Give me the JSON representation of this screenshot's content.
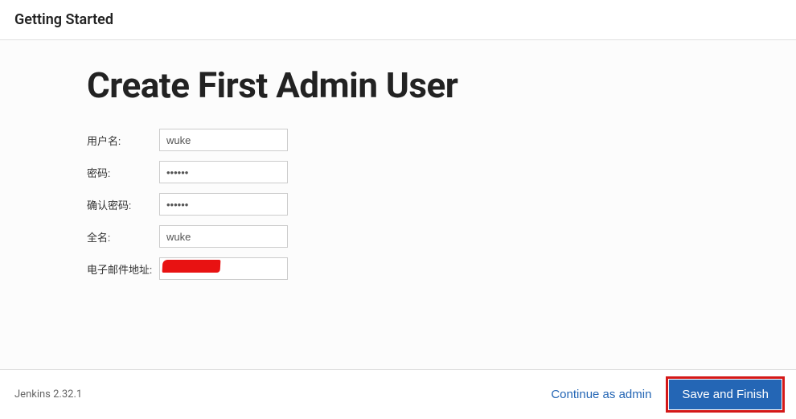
{
  "header": {
    "title": "Getting Started"
  },
  "page": {
    "title": "Create First Admin User"
  },
  "form": {
    "username": {
      "label": "用户名:",
      "value": "wuke"
    },
    "password": {
      "label": "密码:",
      "value": "••••••"
    },
    "confirmPassword": {
      "label": "确认密码:",
      "value": "••••••"
    },
    "fullname": {
      "label": "全名:",
      "value": "wuke"
    },
    "email": {
      "label": "电子邮件地址:",
      "value": ""
    }
  },
  "footer": {
    "version": "Jenkins 2.32.1",
    "continueLabel": "Continue as admin",
    "saveLabel": "Save and Finish"
  }
}
